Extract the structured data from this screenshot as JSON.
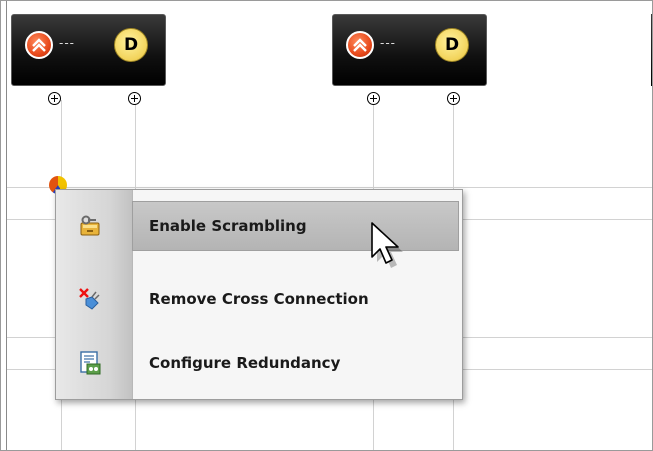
{
  "nodes": [
    {
      "name": "node-left",
      "separator": "---",
      "badge": "D"
    },
    {
      "name": "node-right",
      "separator": "---",
      "badge": "D"
    }
  ],
  "context_menu": {
    "items": [
      {
        "label": "Enable Scrambling",
        "icon": "key-lock-icon",
        "highlighted": true
      },
      {
        "label": "Remove Cross Connection",
        "icon": "remove-connection-icon",
        "highlighted": false
      },
      {
        "label": "Configure Redundancy",
        "icon": "redundancy-config-icon",
        "highlighted": false
      }
    ]
  },
  "colors": {
    "node_background": "#101010",
    "badge_yellow": "#f2d35a",
    "alarm_red": "#e84a1c",
    "menu_highlight": "#b4b4b4"
  }
}
